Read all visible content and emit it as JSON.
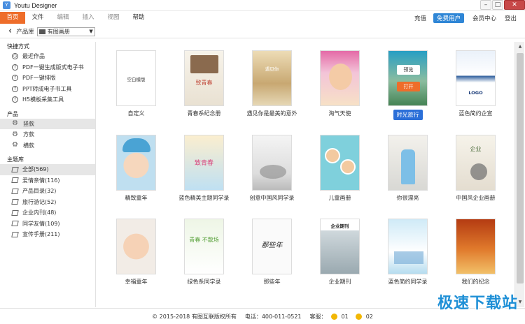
{
  "window": {
    "title": "Youtu Designer",
    "icon": "app-logo-icon"
  },
  "menu": {
    "items": [
      "首页",
      "文件",
      "编辑",
      "插入",
      "视图",
      "帮助"
    ],
    "right": {
      "recharge": "充值",
      "vip": "免费用户",
      "member": "会员中心",
      "logout": "登出"
    }
  },
  "toolbar": {
    "library_label": "产品库",
    "library_value": "有图画册"
  },
  "sidebar": {
    "shortcuts_title": "快捷方式",
    "shortcuts": [
      "最近作品",
      "PDF一键生成版式电子书",
      "PDF一键排版",
      "PPT转成电子书工具",
      "H5模板采集工具"
    ],
    "products_title": "产品",
    "products": [
      "竖款",
      "方款",
      "横款"
    ],
    "themes_title": "主题库",
    "themes": [
      "全部(569)",
      "爱情亲情(116)",
      "产品目录(32)",
      "旅行游记(52)",
      "企业内刊(48)",
      "同学友情(109)",
      "宣传手册(211)"
    ]
  },
  "templates": [
    {
      "name": "自定义",
      "label": "空白模版"
    },
    {
      "name": "青春系纪念册",
      "label": "致青春"
    },
    {
      "name": "遇见你是最美的意外",
      "label": "遇见你"
    },
    {
      "name": "淘气天使",
      "label": ""
    },
    {
      "name": "时光旅行",
      "label": ""
    },
    {
      "name": "蓝色简约企宣",
      "label": "LOGO"
    },
    {
      "name": "精致童年",
      "label": ""
    },
    {
      "name": "蓝色精美主题同学录",
      "label": "致青春"
    },
    {
      "name": "创意中国风同学录",
      "label": ""
    },
    {
      "name": "儿童画册",
      "label": ""
    },
    {
      "name": "你很漂亮",
      "label": ""
    },
    {
      "name": "中国风企业画册",
      "label": "企业"
    },
    {
      "name": "幸福童年",
      "label": ""
    },
    {
      "name": "绿色系同学录",
      "label": "青春 不散场"
    },
    {
      "name": "那些年",
      "label": "那些年"
    },
    {
      "name": "企业期刊",
      "label": "企业期刊"
    },
    {
      "name": "蓝色简约同学录",
      "label": ""
    },
    {
      "name": "我们的纪念",
      "label": ""
    }
  ],
  "hover": {
    "preview": "预览",
    "open": "打开"
  },
  "footer": {
    "copyright": "© 2015-2018 有图互联版权所有",
    "phone": "电话：400-011-0521",
    "service": "客服：",
    "qq1": "01",
    "qq2": "02"
  },
  "watermark": "极速下载站",
  "colors": {
    "accent": "#ee6d2a",
    "selected": "#2b6fd8",
    "vip": "#2f86d6",
    "watermark": "#1e8fd6"
  }
}
